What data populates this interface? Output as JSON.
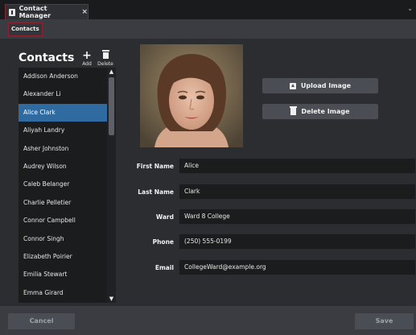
{
  "window": {
    "tab_title": "Contact Manager",
    "tab_close": "×",
    "corner_arrow": "⌄"
  },
  "subnav": {
    "active_tab": "Contacts"
  },
  "sidebar": {
    "title": "Contacts",
    "add_icon": "+",
    "add_label": "Add",
    "delete_label": "Delete",
    "scroll_up": "▲",
    "scroll_down": "▼",
    "selected_index": 2,
    "items": [
      "Addison Anderson",
      "Alexander Li",
      "Alice Clark",
      "Aliyah Landry",
      "Asher Johnston",
      "Audrey Wilson",
      "Caleb Belanger",
      "Charlie Pelletier",
      "Connor Campbell",
      "Connor Singh",
      "Elizabeth Poirier",
      "Emilia Stewart",
      "Emma Girard"
    ]
  },
  "image_actions": {
    "upload_label": "Upload Image",
    "delete_label": "Delete Image"
  },
  "form": {
    "first_name": {
      "label": "First Name",
      "value": "Alice"
    },
    "last_name": {
      "label": "Last Name",
      "value": "Clark"
    },
    "ward": {
      "label": "Ward",
      "value": "Ward 8 College"
    },
    "phone": {
      "label": "Phone",
      "value": "(250) 555-0199"
    },
    "email": {
      "label": "Email",
      "value": "CollegeWard@example.org"
    }
  },
  "footer": {
    "cancel_label": "Cancel",
    "save_label": "Save"
  },
  "colors": {
    "accent_selected": "#2f6aa0",
    "tab_highlight": "#8b2331",
    "background": "#2b2d31"
  }
}
